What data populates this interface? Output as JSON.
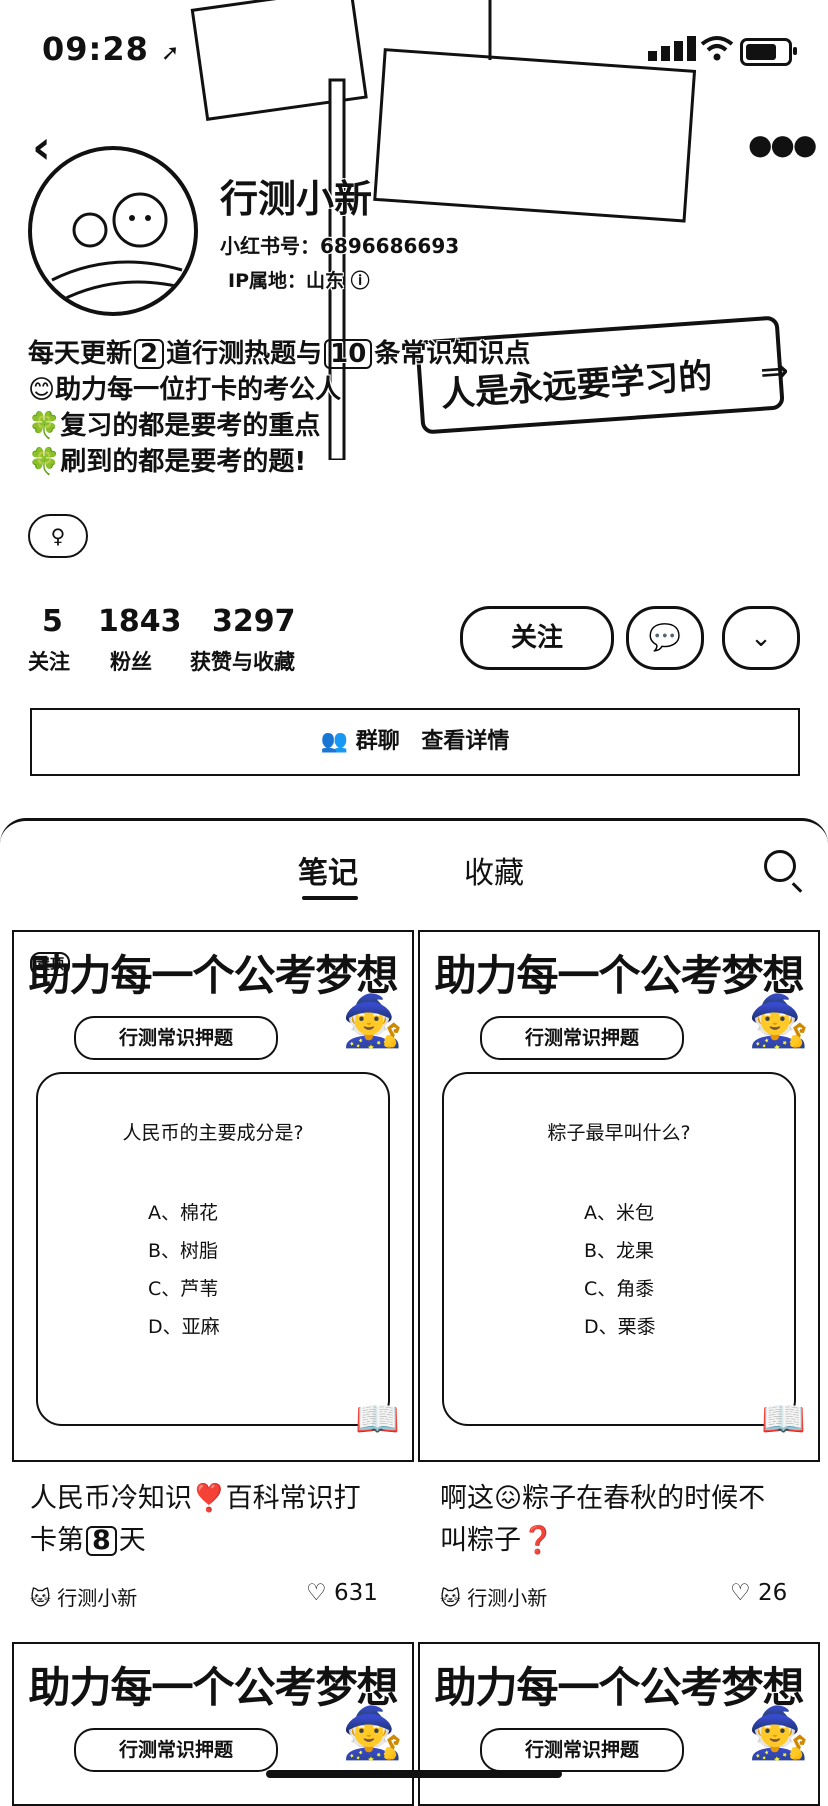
{
  "status_bar": {
    "time": "09:28",
    "battery_percent": 75
  },
  "profile": {
    "name": "行测小新",
    "red_id": "小红书号：6896686693",
    "ip_location": "IP属地：山东",
    "bio_line1_parts": [
      "每天更新",
      "2",
      "道行测热题与",
      "10",
      "条常识知识点"
    ],
    "bio_line2": "😊助力每一位打卡的考公人",
    "bio_line3": "🍀复习的都是要考的重点",
    "bio_line4": "🍀刷到的都是要考的题!",
    "gender_icon": "female-icon",
    "background_sign_text": "人是永远要学习的"
  },
  "stats": [
    {
      "value": "5",
      "label": "关注"
    },
    {
      "value": "1843",
      "label": "粉丝"
    },
    {
      "value": "3297",
      "label": "获赞与收藏"
    }
  ],
  "actions": {
    "follow_label": "关注",
    "message_icon": "chat-bubble-icon",
    "dropdown_icon": "chevron-down-icon"
  },
  "group_bar": {
    "label1": "群聊",
    "label2": "查看详情"
  },
  "tabs": [
    {
      "label": "笔记",
      "active": true
    },
    {
      "label": "收藏",
      "active": false
    }
  ],
  "cards": [
    {
      "pinned_label": "置顶",
      "headline": "助力每一个公考梦想",
      "pill": "行测常识押题",
      "question": "人民币的主要成分是?",
      "options": [
        "A、棉花",
        "B、树脂",
        "C、芦苇",
        "D、亚麻"
      ],
      "title_line1": "人民币冷知识❣️百科常识打",
      "title_line2_pre": "卡第",
      "title_line2_num": "8",
      "title_line2_post": "天",
      "author": "行测小新",
      "likes": "631"
    },
    {
      "headline": "助力每一个公考梦想",
      "pill": "行测常识押题",
      "question": "粽子最早叫什么?",
      "options": [
        "A、米包",
        "B、龙果",
        "C、角黍",
        "D、栗黍"
      ],
      "title_line1": "啊这😖粽子在春秋的时候不",
      "title_line2_pre": "叫粽子❓",
      "title_line2_num": "",
      "title_line2_post": "",
      "author": "行测小新",
      "likes": "26"
    },
    {
      "headline": "助力每一个公考梦想",
      "pill": "行测常识押题"
    },
    {
      "headline": "助力每一个公考梦想",
      "pill": "行测常识押题"
    }
  ]
}
